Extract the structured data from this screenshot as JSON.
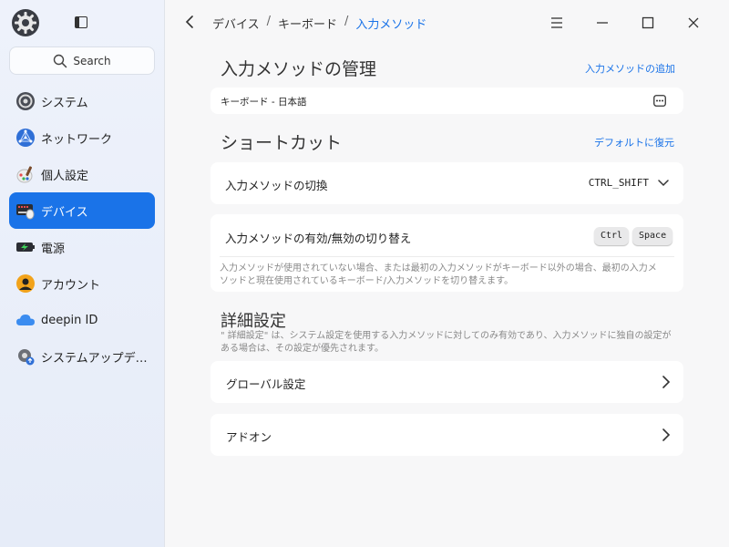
{
  "sidebar": {
    "search_label": "Search",
    "items": [
      {
        "label": "システム",
        "icon": "system-icon"
      },
      {
        "label": "ネットワーク",
        "icon": "network-icon"
      },
      {
        "label": "個人設定",
        "icon": "personalization-icon"
      },
      {
        "label": "デバイス",
        "icon": "device-icon",
        "active": true
      },
      {
        "label": "電源",
        "icon": "power-icon"
      },
      {
        "label": "アカウント",
        "icon": "account-icon"
      },
      {
        "label": "deepin ID",
        "icon": "cloud-icon"
      },
      {
        "label": "システムアップデ…",
        "icon": "update-icon"
      }
    ]
  },
  "breadcrumb": {
    "items": [
      "デバイス",
      "キーボード",
      "入力メソッド"
    ]
  },
  "input_method_management": {
    "title": "入力メソッドの管理",
    "add_link": "入力メソッドの追加",
    "entry": "キーボード - 日本語"
  },
  "shortcuts": {
    "title": "ショートカット",
    "restore_link": "デフォルトに復元",
    "switch_label": "入力メソッドの切換",
    "switch_value": "CTRL_SHIFT",
    "toggle_label": "入力メソッドの有効/無効の切り替え",
    "toggle_keys": [
      "Ctrl",
      "Space"
    ],
    "toggle_desc": "入力メソッドが使用されていない場合、または最初の入力メソッドがキーボード以外の場合、最初の入力メソッドと現在使用されているキーボード/入力メソッドを切り替えます。"
  },
  "advanced": {
    "title": "詳細設定",
    "desc": "\" 詳細設定\" は、システム設定を使用する入力メソッドに対してのみ有効であり、入力メソッドに独自の設定がある場合は、その設定が優先されます。",
    "global_label": "グローバル設定",
    "addon_label": "アドオン"
  },
  "colors": {
    "accent": "#1a73e8",
    "sidebar_bg": "#eef2fb",
    "main_bg": "#f7f7f8"
  }
}
